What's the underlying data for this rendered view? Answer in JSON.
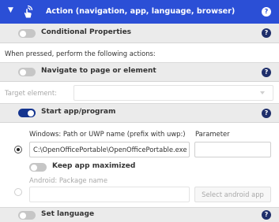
{
  "header": {
    "title": "Action (navigation, app, language, browser)",
    "help": "?"
  },
  "conditional": {
    "label": "Conditional Properties",
    "help": "?",
    "enabled": false
  },
  "pressed_text": "When pressed, perform the following actions:",
  "navigate": {
    "label": "Navigate to page or element",
    "help": "?",
    "enabled": false,
    "target_label": "Target element:"
  },
  "start_app": {
    "label": "Start app/program",
    "help": "?",
    "enabled": true,
    "windows_label": "Windows: Path or UWP name (prefix with uwp:)",
    "windows_value": "C:\\OpenOfficePortable\\OpenOfficePortable.exe",
    "parameter_label": "Parameter",
    "parameter_value": "",
    "keep_max_label": "Keep app maximized",
    "android_label": "Android: Package name",
    "android_value": "",
    "select_android_label": "Select android app",
    "selected_option": "windows"
  },
  "set_language": {
    "label": "Set language",
    "help": "?",
    "enabled": false
  },
  "colors": {
    "header": "#2b4fd6",
    "toggle_on": "#14348f",
    "toggle_off": "#c6c6c6",
    "help_bg": "#1f2f6b"
  }
}
